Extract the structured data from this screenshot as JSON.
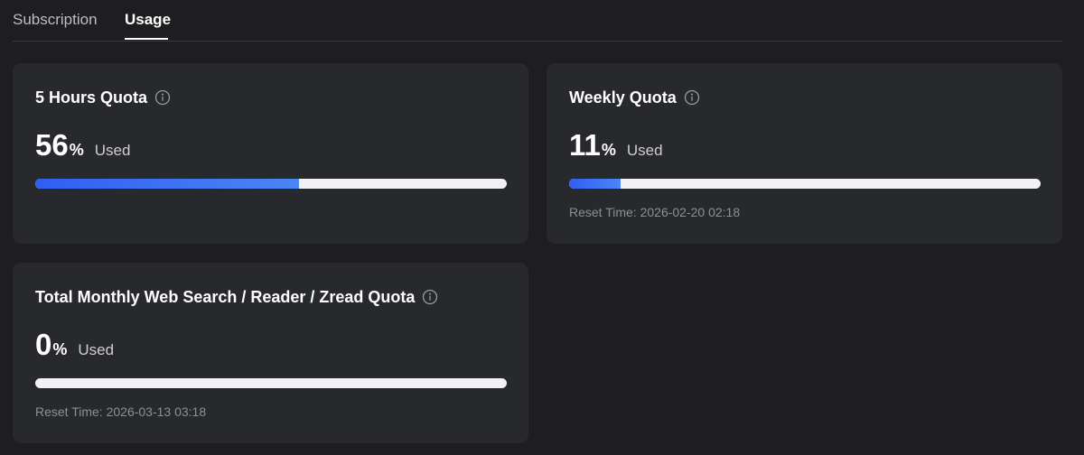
{
  "tabs": [
    {
      "label": "Subscription",
      "active": false
    },
    {
      "label": "Usage",
      "active": true
    }
  ],
  "cards": [
    {
      "title": "5 Hours Quota",
      "percent": "56",
      "percent_sign": "%",
      "used_label": "Used",
      "progress": 0.56,
      "reset_time": ""
    },
    {
      "title": "Weekly Quota",
      "percent": "11",
      "percent_sign": "%",
      "used_label": "Used",
      "progress": 0.11,
      "reset_time": "Reset Time: 2026-02-20 02:18"
    },
    {
      "title": "Total Monthly Web Search / Reader / Zread Quota",
      "percent": "0",
      "percent_sign": "%",
      "used_label": "Used",
      "progress": 0,
      "reset_time": "Reset Time: 2026-03-13 03:18"
    }
  ],
  "icons": {
    "info": "info-circle-icon"
  },
  "colors": {
    "page_bg": "#1e1e20",
    "card_bg": "#28292d",
    "bar_track": "#f2f2f5",
    "bar_fill_start": "#2f5ff2",
    "bar_fill_end": "#4a86f4",
    "muted_text": "#8e8f96"
  }
}
